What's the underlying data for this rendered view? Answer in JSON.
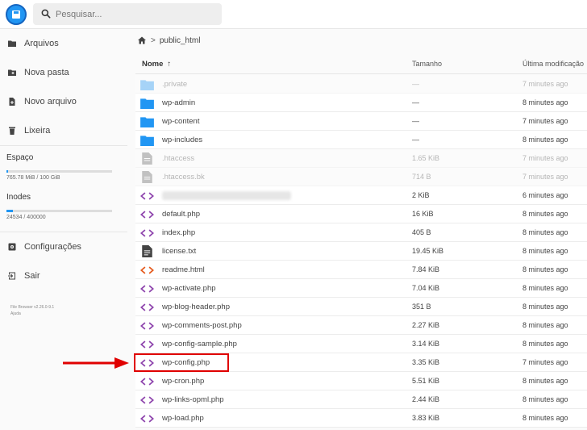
{
  "search": {
    "placeholder": "Pesquisar..."
  },
  "sidebar": {
    "items": [
      {
        "label": "Arquivos",
        "icon": "folder-icon"
      },
      {
        "label": "Nova pasta",
        "icon": "new-folder-icon"
      },
      {
        "label": "Novo arquivo",
        "icon": "new-file-icon"
      },
      {
        "label": "Lixeira",
        "icon": "trash-icon"
      }
    ],
    "storage": {
      "label": "Espaço",
      "text": "765.78 MiB / 100 GiB",
      "fraction": 0.008
    },
    "inodes": {
      "label": "Inodes",
      "text": "24534 / 400000",
      "fraction": 0.061
    },
    "settings_label": "Configurações",
    "logout_label": "Sair",
    "credits": [
      "File Browser v2.26.0-9.1",
      "Ajuda"
    ]
  },
  "breadcrumb": {
    "path": "public_html"
  },
  "table": {
    "headers": {
      "name": "Nome",
      "sort_arrow": "↑",
      "size": "Tamanho",
      "modified": "Última modificação"
    },
    "rows": [
      {
        "name": ".private",
        "size": "—",
        "modified": "7 minutes ago",
        "type": "folder",
        "dim": true
      },
      {
        "name": "wp-admin",
        "size": "—",
        "modified": "8 minutes ago",
        "type": "folder",
        "dim": false
      },
      {
        "name": "wp-content",
        "size": "—",
        "modified": "7 minutes ago",
        "type": "folder",
        "dim": false
      },
      {
        "name": "wp-includes",
        "size": "—",
        "modified": "8 minutes ago",
        "type": "folder",
        "dim": false
      },
      {
        "name": ".htaccess",
        "size": "1.65 KiB",
        "modified": "7 minutes ago",
        "type": "file",
        "dim": true
      },
      {
        "name": ".htaccess.bk",
        "size": "714 B",
        "modified": "7 minutes ago",
        "type": "file",
        "dim": true
      },
      {
        "name": "",
        "size": "2 KiB",
        "modified": "6 minutes ago",
        "type": "code",
        "dim": false,
        "blurred": true
      },
      {
        "name": "default.php",
        "size": "16 KiB",
        "modified": "8 minutes ago",
        "type": "code",
        "dim": false
      },
      {
        "name": "index.php",
        "size": "405 B",
        "modified": "8 minutes ago",
        "type": "code",
        "dim": false
      },
      {
        "name": "license.txt",
        "size": "19.45 KiB",
        "modified": "8 minutes ago",
        "type": "text",
        "dim": false
      },
      {
        "name": "readme.html",
        "size": "7.84 KiB",
        "modified": "8 minutes ago",
        "type": "html",
        "dim": false
      },
      {
        "name": "wp-activate.php",
        "size": "7.04 KiB",
        "modified": "8 minutes ago",
        "type": "code",
        "dim": false
      },
      {
        "name": "wp-blog-header.php",
        "size": "351 B",
        "modified": "8 minutes ago",
        "type": "code",
        "dim": false
      },
      {
        "name": "wp-comments-post.php",
        "size": "2.27 KiB",
        "modified": "8 minutes ago",
        "type": "code",
        "dim": false
      },
      {
        "name": "wp-config-sample.php",
        "size": "3.14 KiB",
        "modified": "8 minutes ago",
        "type": "code",
        "dim": false
      },
      {
        "name": "wp-config.php",
        "size": "3.35 KiB",
        "modified": "7 minutes ago",
        "type": "code",
        "dim": false
      },
      {
        "name": "wp-cron.php",
        "size": "5.51 KiB",
        "modified": "8 minutes ago",
        "type": "code",
        "dim": false
      },
      {
        "name": "wp-links-opml.php",
        "size": "2.44 KiB",
        "modified": "8 minutes ago",
        "type": "code",
        "dim": false
      },
      {
        "name": "wp-load.php",
        "size": "3.83 KiB",
        "modified": "8 minutes ago",
        "type": "code",
        "dim": false
      }
    ]
  },
  "colors": {
    "accent": "#2196f3",
    "code_icon": "#8e44ad",
    "html_icon": "#e55a1c",
    "highlight": "#e00000"
  }
}
